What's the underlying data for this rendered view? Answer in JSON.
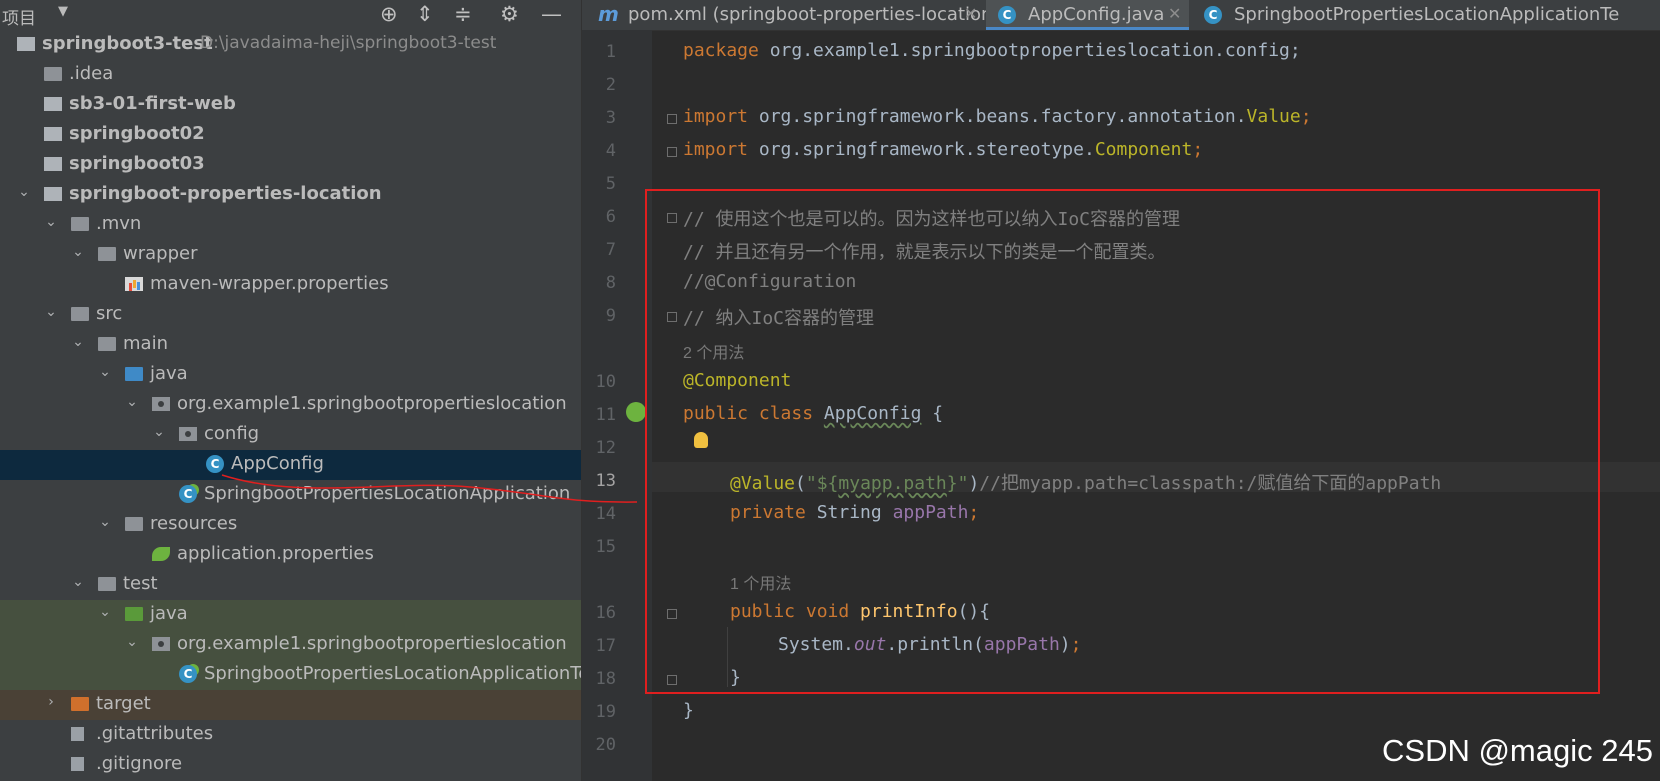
{
  "project_panel": {
    "title": "项目",
    "toolbar_icons": [
      "locate-icon",
      "expand-all-icon",
      "collapse-all-icon",
      "gear-icon",
      "minimize-icon"
    ]
  },
  "tree": [
    {
      "label": "springboot3-test",
      "path": "D:\\javadaima-heji\\springboot3-test",
      "bold": true,
      "arrow": "v",
      "icon": "module"
    },
    {
      "label": ".idea",
      "icon": "folder"
    },
    {
      "label": "sb3-01-first-web",
      "bold": true,
      "icon": "module"
    },
    {
      "label": "springboot02",
      "bold": true,
      "icon": "module"
    },
    {
      "label": "springboot03",
      "bold": true,
      "icon": "module"
    },
    {
      "label": "springboot-properties-location",
      "bold": true,
      "arrow": "v",
      "icon": "module"
    },
    {
      "label": ".mvn",
      "arrow": "v",
      "icon": "folder"
    },
    {
      "label": "wrapper",
      "arrow": "v",
      "icon": "folder"
    },
    {
      "label": "maven-wrapper.properties",
      "icon": "properties"
    },
    {
      "label": "src",
      "arrow": "v",
      "icon": "folder"
    },
    {
      "label": "main",
      "arrow": "v",
      "icon": "folder"
    },
    {
      "label": "java",
      "arrow": "v",
      "icon": "folder-blue"
    },
    {
      "label": "org.example1.springbootpropertieslocation",
      "arrow": "v",
      "icon": "package"
    },
    {
      "label": "config",
      "arrow": "v",
      "icon": "package"
    },
    {
      "label": "AppConfig",
      "icon": "class",
      "selected": true
    },
    {
      "label": "SpringbootPropertiesLocationApplication",
      "icon": "spring-class"
    },
    {
      "label": "resources",
      "arrow": "v",
      "icon": "folder"
    },
    {
      "label": "application.properties",
      "icon": "spring-leaf"
    },
    {
      "label": "test",
      "arrow": "v",
      "icon": "folder"
    },
    {
      "label": "java",
      "arrow": "v",
      "icon": "folder-green"
    },
    {
      "label": "org.example1.springbootpropertieslocation",
      "arrow": "v",
      "icon": "package"
    },
    {
      "label": "SpringbootPropertiesLocationApplicationTests",
      "icon": "spring-class"
    },
    {
      "label": "target",
      "arrow": ">",
      "icon": "folder-orange"
    },
    {
      "label": ".gitattributes",
      "icon": "file"
    },
    {
      "label": ".gitignore",
      "icon": "file"
    }
  ],
  "tabs": [
    {
      "label": "pom.xml (springboot-properties-location)",
      "icon": "maven-icon",
      "active": false
    },
    {
      "label": "AppConfig.java",
      "icon": "class-icon",
      "active": true
    },
    {
      "label": "SpringbootPropertiesLocationApplicationTe",
      "icon": "spring-class-icon",
      "active": false
    }
  ],
  "line_numbers": [
    "1",
    "2",
    "3",
    "4",
    "5",
    "6",
    "7",
    "8",
    "9",
    "10",
    "11",
    "12",
    "13",
    "14",
    "15",
    "16",
    "17",
    "18",
    "19",
    "20"
  ],
  "code": {
    "l1_kw": "package",
    "l1_rest": " org.example1.springbootpropertieslocation.config;",
    "l3_kw": "import",
    "l3_rest": " org.springframework.beans.factory.annotation.",
    "l3_cls": "Value",
    "l3_end": ";",
    "l4_kw": "import",
    "l4_rest": " org.springframework.stereotype.",
    "l4_cls": "Component",
    "l4_end": ";",
    "l6": "// 使用这个也是可以的。因为这样也可以纳入IoC容器的管理",
    "l7": "// 并且还有另一个作用，就是表示以下的类是一个配置类。",
    "l8": "//@Configuration",
    "l9": "// 纳入IoC容器的管理",
    "hint1": "2 个用法",
    "l10": "@Component",
    "l11_kw": "public class ",
    "l11_cls": "AppConfig",
    "l11_rest": " {",
    "l13_ann": "@Value",
    "l13_p1": "(",
    "l13_s1": "\"${",
    "l13_key": "myapp.path",
    "l13_s2": "}\"",
    "l13_p2": ")",
    "l13_cmt": "//把myapp.path=classpath:/赋值给下面的appPath",
    "l14_kw": "private ",
    "l14_type": "String ",
    "l14_fld": "appPath",
    "l14_end": ";",
    "hint2": "1 个用法",
    "l16_kw": "public void ",
    "l16_mth": "printInfo",
    "l16_rest": "(){",
    "l17_a": "System.",
    "l17_out": "out",
    "l17_b": ".println(",
    "l17_fld": "appPath",
    "l17_c": ")",
    "l17_end": ";",
    "l18": "}",
    "l19": "}"
  },
  "watermark": "CSDN @magic 245"
}
